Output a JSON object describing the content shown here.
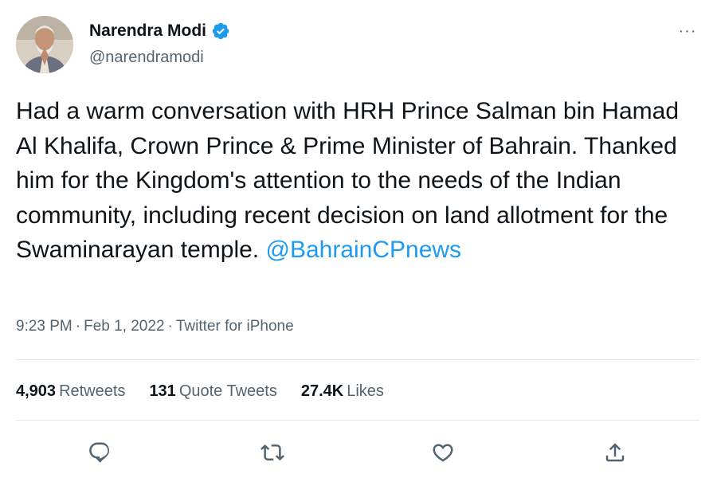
{
  "tweet": {
    "author": {
      "display_name": "Narendra Modi",
      "handle": "@narendramodi",
      "verified": true
    },
    "text_before_mention": "Had a warm conversation with HRH Prince Salman bin Hamad Al Khalifa, Crown Prince & Prime Minister of Bahrain. Thanked him for the Kingdom's attention to the needs of the Indian community, including recent decision on land allotment for the Swaminarayan temple. ",
    "mention": "@BahrainCPnews",
    "time": "9:23 PM",
    "separator": "·",
    "date": "Feb 1, 2022",
    "source": "Twitter for iPhone",
    "more_label": "···"
  },
  "stats": {
    "retweets": {
      "count": "4,903",
      "label": "Retweets"
    },
    "quote_tweets": {
      "count": "131",
      "label": "Quote Tweets"
    },
    "likes": {
      "count": "27.4K",
      "label": "Likes"
    }
  },
  "actions": [
    {
      "icon": "reply-icon"
    },
    {
      "icon": "retweet-icon"
    },
    {
      "icon": "like-icon"
    },
    {
      "icon": "share-icon"
    }
  ],
  "colors": {
    "text": "#0f1419",
    "secondary": "#536471",
    "link": "#1d9bf0",
    "verified": "#1d9bf0",
    "divider": "#e7e9ea"
  }
}
